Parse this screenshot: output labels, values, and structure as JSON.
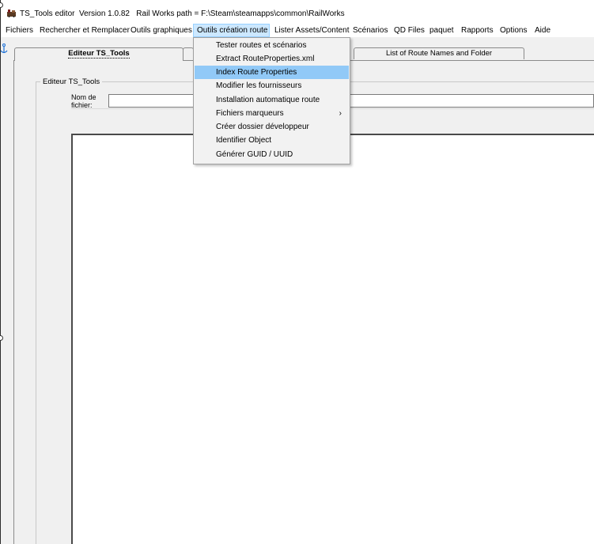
{
  "window": {
    "title": "TS_Tools editor  Version 1.0.82   Rail Works path = F:\\Steam\\steamapps\\common\\RailWorks",
    "icon": "app-train-icon"
  },
  "menubar": {
    "items": [
      {
        "label": "Fichiers"
      },
      {
        "label": "Rechercher et Remplacer"
      },
      {
        "label": "Outils graphiques"
      },
      {
        "label": "Outils création route",
        "active": true
      },
      {
        "label": "Lister Assets/Content"
      },
      {
        "label": "Scénarios"
      },
      {
        "label": "QD Files"
      },
      {
        "label": "paquet"
      },
      {
        "label": "Rapports"
      },
      {
        "label": "Options"
      },
      {
        "label": "Aide"
      }
    ]
  },
  "dropdown": {
    "items": [
      {
        "label": "Tester routes et scénarios"
      },
      {
        "label": "Extract RouteProperties.xml"
      },
      {
        "label": "Index Route Properties",
        "highlighted": true
      },
      {
        "label": "Modifier les fournisseurs"
      },
      {
        "label": "Installation automatique route"
      },
      {
        "label": "Fichiers marqueurs",
        "submenu": true,
        "arrow": "›"
      },
      {
        "label": "Créer dossier développeur"
      },
      {
        "label": "Identifier Object"
      },
      {
        "label": "Générer GUID / UUID"
      }
    ]
  },
  "tabs": [
    {
      "label": "Editeur TS_Tools",
      "selected": true
    },
    {
      "label": ""
    },
    {
      "label": "List of Route Names and Folder"
    }
  ],
  "editor": {
    "group_title": "Editeur TS_Tools",
    "file_label": "Nom de fichier:",
    "file_value": ""
  },
  "colors": {
    "menu_active_bg": "#cce8ff",
    "dropdown_highlight": "#91c9f7",
    "panel_bg": "#f0f0f0"
  }
}
